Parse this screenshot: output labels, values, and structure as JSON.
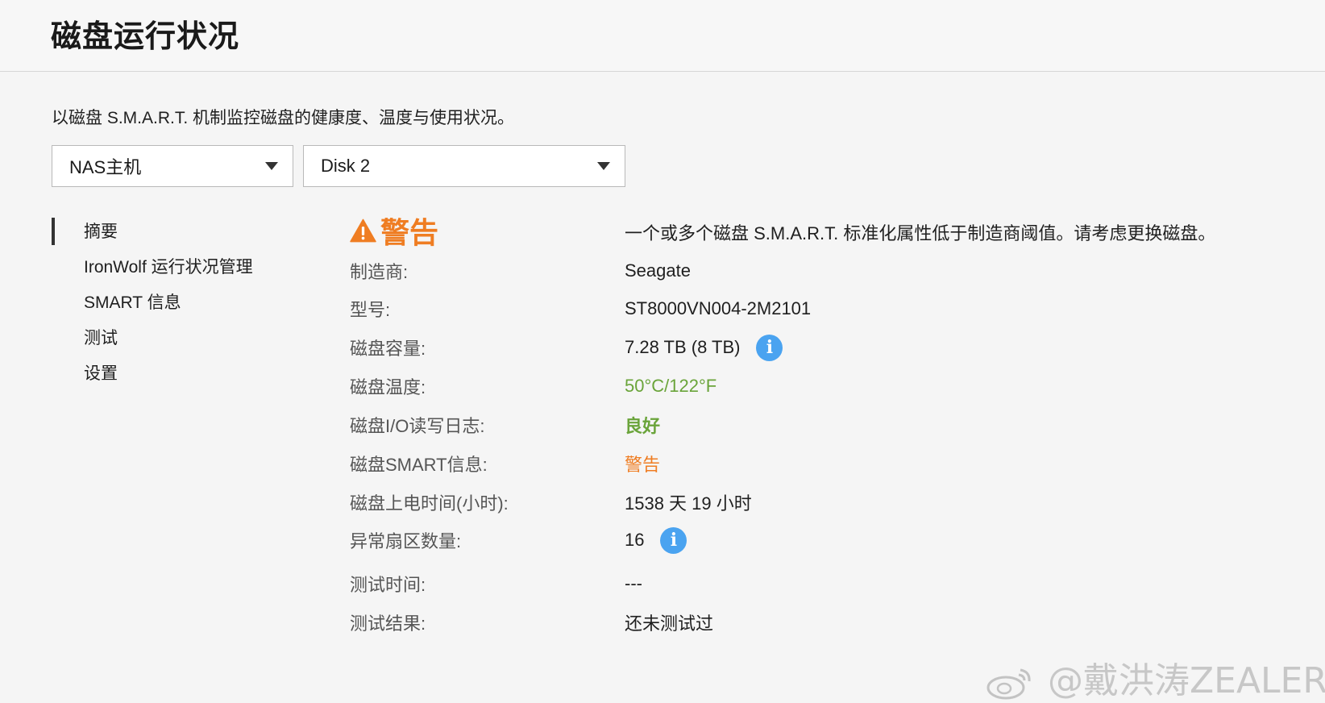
{
  "header": {
    "title": "磁盘运行状况"
  },
  "description": "以磁盘 S.M.A.R.T. 机制监控磁盘的健康度、温度与使用状况。",
  "selectors": {
    "host": {
      "value": "NAS主机"
    },
    "disk": {
      "value": "Disk 2"
    }
  },
  "sidebar": {
    "items": [
      {
        "label": "摘要",
        "active": true
      },
      {
        "label": "IronWolf 运行状况管理"
      },
      {
        "label": "SMART 信息"
      },
      {
        "label": "测试"
      },
      {
        "label": "设置"
      }
    ]
  },
  "status": {
    "label": "警告",
    "message": "一个或多个磁盘 S.M.A.R.T. 标准化属性低于制造商阈值。请考虑更换磁盘。",
    "icon": "warning-triangle-icon",
    "color": "#ef7d22"
  },
  "info": {
    "manufacturer": {
      "label": "制造商:",
      "value": "Seagate"
    },
    "model": {
      "label": "型号:",
      "value": "ST8000VN004-2M2101"
    },
    "capacity": {
      "label": "磁盘容量:",
      "value": "7.28 TB (8 TB)",
      "icon": "info-icon"
    },
    "temperature": {
      "label": "磁盘温度:",
      "value": "50°C/122°F",
      "color": "#6aa43a"
    },
    "io_log": {
      "label": "磁盘I/O读写日志:",
      "value": "良好",
      "color": "#6aa43a"
    },
    "smart": {
      "label": "磁盘SMART信息:",
      "value": "警告",
      "color": "#ef7d22"
    },
    "power_on": {
      "label": "磁盘上电时间(小时):",
      "value": "1538 天 19 小时"
    },
    "bad_sectors": {
      "label": "异常扇区数量:",
      "value": "16",
      "icon": "info-icon"
    },
    "test_time": {
      "label": "测试时间:",
      "value": "---"
    },
    "test_result": {
      "label": "测试结果:",
      "value": "还未测试过"
    }
  },
  "info_icon_glyph": "i",
  "watermark": {
    "text": "@戴洪涛ZEALER",
    "icon": "weibo-logo-icon"
  }
}
